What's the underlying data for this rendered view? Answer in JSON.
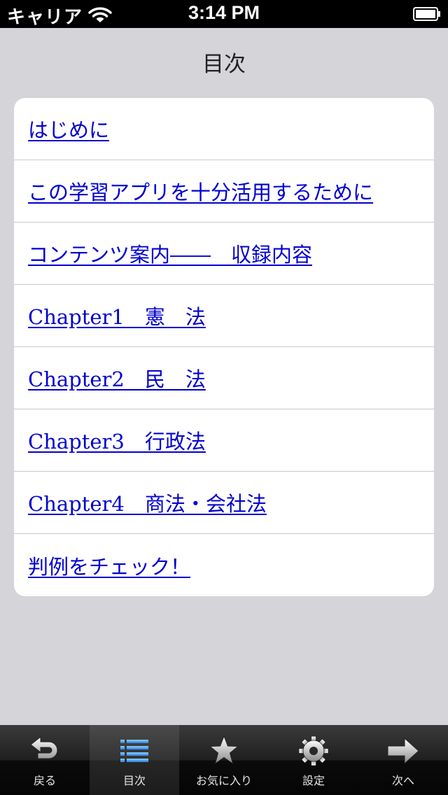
{
  "status_bar": {
    "carrier": "キャリア",
    "time": "3:14 PM"
  },
  "page": {
    "title": "目次"
  },
  "toc": [
    {
      "label": "はじめに"
    },
    {
      "label": "この学習アプリを十分活用するために"
    },
    {
      "label": "コンテンツ案内――　収録内容"
    },
    {
      "label": "Chapter1　憲　法"
    },
    {
      "label": "Chapter2　民　法"
    },
    {
      "label": "Chapter3　行政法"
    },
    {
      "label": "Chapter4　商法・会社法"
    },
    {
      "label": "判例をチェック！"
    }
  ],
  "tab_bar": {
    "active_index": 1,
    "tabs": [
      {
        "label": "戻る",
        "icon": "back-arrow-icon"
      },
      {
        "label": "目次",
        "icon": "list-icon"
      },
      {
        "label": "お気に入り",
        "icon": "star-icon"
      },
      {
        "label": "設定",
        "icon": "gear-icon"
      },
      {
        "label": "次へ",
        "icon": "forward-arrow-icon"
      }
    ]
  },
  "colors": {
    "link": "#0000d0",
    "background": "#d5d4d9",
    "active_icon": "#3a8fe6"
  }
}
